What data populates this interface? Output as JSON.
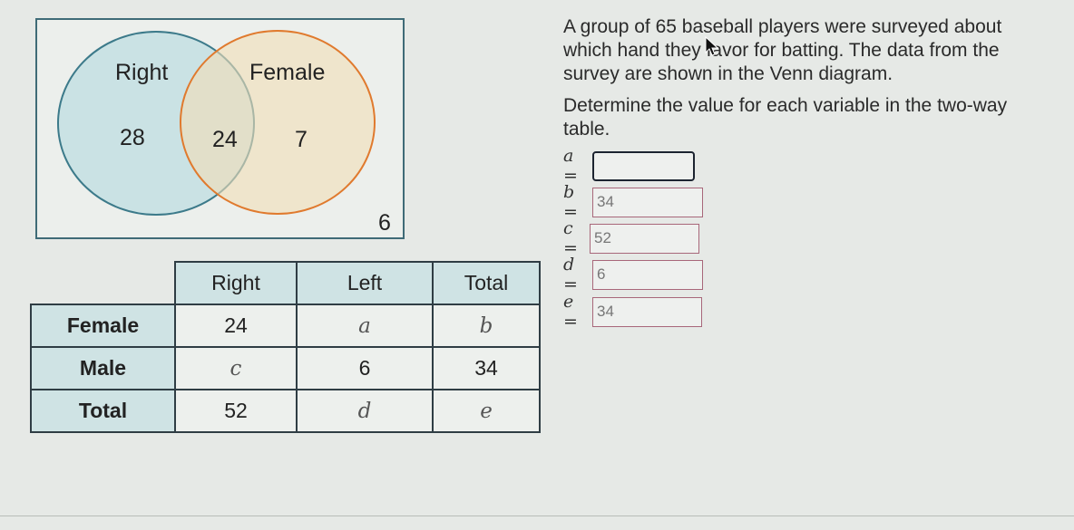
{
  "venn": {
    "left_set_label": "Right",
    "right_set_label": "Female",
    "only_left": "28",
    "both": "24",
    "only_right": "7",
    "neither": "6",
    "left_color": "#3c7a8a",
    "right_color": "#e07a2e"
  },
  "question": {
    "paragraph1": "A group of 65 baseball players were surveyed about which hand they favor for batting. The data from the survey are shown in the Venn diagram.",
    "paragraph2": "Determine the value for each variable in the two-way table."
  },
  "answers": [
    {
      "var": "a",
      "eq": "=",
      "value": "",
      "active": true
    },
    {
      "var": "b",
      "eq": "=",
      "value": "34",
      "active": false
    },
    {
      "var": "c",
      "eq": "=",
      "value": "52",
      "active": false
    },
    {
      "var": "d",
      "eq": "=",
      "value": "6",
      "active": false
    },
    {
      "var": "e",
      "eq": "=",
      "value": "34",
      "active": false
    }
  ],
  "table": {
    "columns": [
      "Right",
      "Left",
      "Total"
    ],
    "rows": [
      {
        "label": "Female",
        "cells": [
          "24",
          "a",
          "b"
        ]
      },
      {
        "label": "Male",
        "cells": [
          "c",
          "6",
          "34"
        ]
      },
      {
        "label": "Total",
        "cells": [
          "52",
          "d",
          "e"
        ]
      }
    ]
  }
}
